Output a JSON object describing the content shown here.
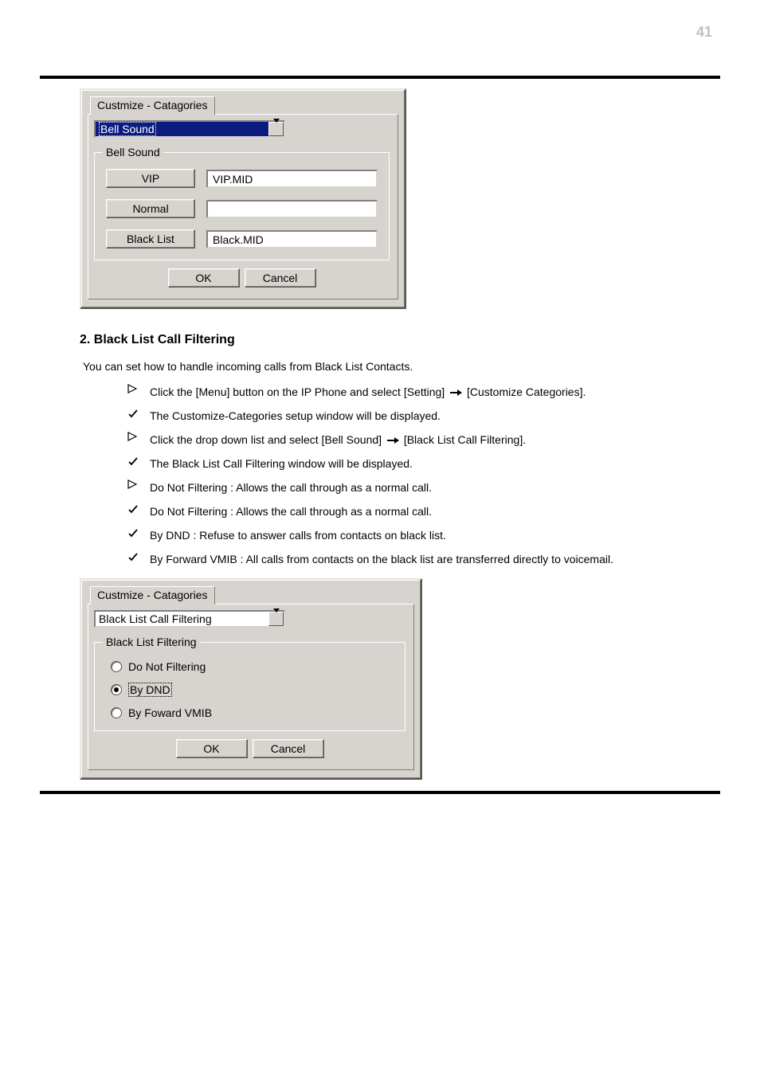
{
  "page_number": "41",
  "dialog1": {
    "tab_label": "Custmize - Catagories",
    "combo_value": "Bell Sound",
    "fieldset_title": "Bell Sound",
    "buttons": {
      "vip": "VIP",
      "normal": "Normal",
      "black": "Black List"
    },
    "values": {
      "vip": "VIP.MID",
      "normal": "",
      "black": "Black.MID"
    },
    "ok": "OK",
    "cancel": "Cancel"
  },
  "outline": {
    "title": "2. Black List Call Filtering",
    "intro": "You can set how to handle incoming calls from Black List Contacts.",
    "step1_pre": "Click the [Menu] button on the IP Phone and select [Setting] ",
    "step1_post": " [Customize Categories].",
    "res1": "The Customize-Categories setup window will be displayed.",
    "step2_pre": "Click the drop down list and select [Bell Sound] ",
    "step2_post": " [Black List Call Filtering].",
    "res2": "The Black List Call Filtering window will be displayed.",
    "step3": "Do Not Filtering : Allows the call through as a normal call.",
    "step4": "By DND : Refuse to answer calls from contacts on black list.",
    "step5": "By Forward VMIB : All calls from contacts on the black list are transferred directly to voicemail."
  },
  "dialog2": {
    "tab_label": "Custmize - Catagories",
    "combo_value": "Black List Call Filtering",
    "fieldset_title": "Black List Filtering",
    "options": {
      "opt1": "Do Not Filtering",
      "opt2": "By DND",
      "opt3": "By Foward VMIB"
    },
    "ok": "OK",
    "cancel": "Cancel"
  }
}
